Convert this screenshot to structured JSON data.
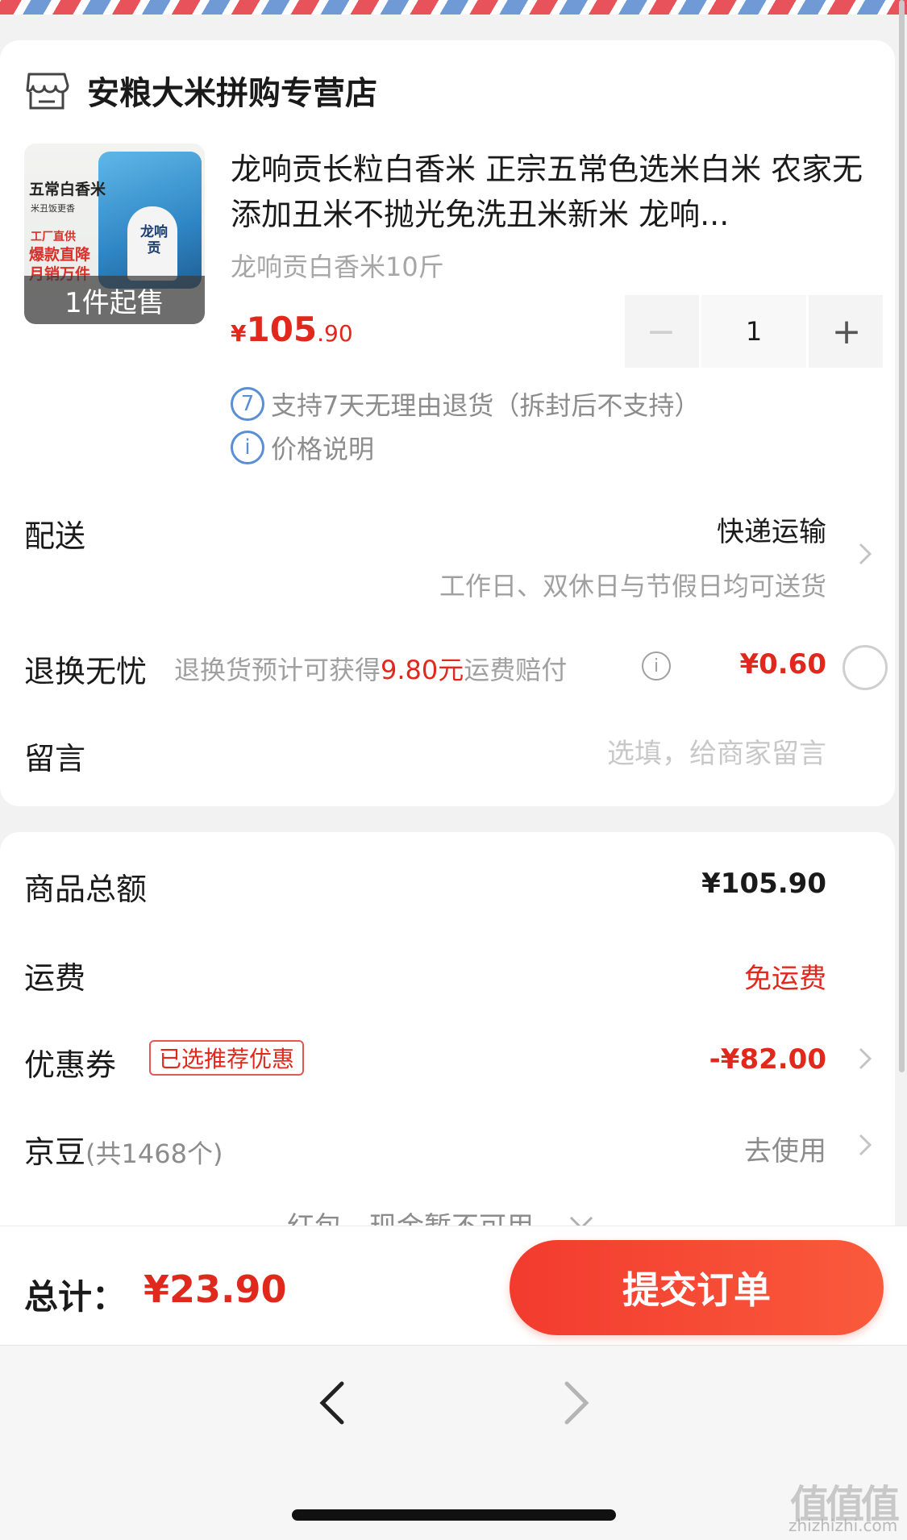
{
  "store": {
    "name": "安粮大米拼购专营店",
    "icon": "store-icon"
  },
  "product": {
    "title": "龙响贡长粒白香米 正宗五常色选米白米 农家无添加丑米不抛光免洗丑米新米 龙响...",
    "spec": "龙响贡白香米10斤",
    "thumbnail": {
      "line1": "五常白香米",
      "line2": "米丑饭更香",
      "line3": "工厂直供",
      "line4a": "爆款直降",
      "line4b": "月销万件",
      "bag_brand": "龙响贡",
      "overlay": "1件起售"
    },
    "price": {
      "currency": "¥",
      "integer": "105",
      "decimal": ".90"
    },
    "quantity": "1",
    "minus_label": "−",
    "plus_label": "+"
  },
  "policies": [
    {
      "icon_text": "7",
      "text": "支持7天无理由退货（拆封后不支持）"
    },
    {
      "icon_text": "i",
      "text": "价格说明"
    }
  ],
  "delivery": {
    "label": "配送",
    "method": "快递运输",
    "note": "工作日、双休日与节假日均可送货"
  },
  "returns": {
    "label": "退换无忧",
    "desc_prefix": "退换货预计可获得",
    "desc_amount": "9.80元",
    "desc_suffix": "运费赔付",
    "info_icon": "i",
    "price": "¥0.60"
  },
  "message": {
    "label": "留言",
    "placeholder": "选填，给商家留言"
  },
  "summary": {
    "goods_total_label": "商品总额",
    "goods_total_value": "¥105.90",
    "shipping_label": "运费",
    "shipping_value": "免运费",
    "coupon_label": "优惠券",
    "coupon_badge": "已选推荐优惠",
    "coupon_value": "-¥82.00",
    "jingdou_label": "京豆",
    "jingdou_count": "(共1468个)",
    "jingdou_action": "去使用",
    "redpack_text": "红包、现金暂不可用"
  },
  "footer": {
    "total_label": "总计：",
    "total_value": "¥23.90",
    "submit_label": "提交订单"
  },
  "watermark": {
    "logo": "值值值",
    "url": "zhizhizhi.com"
  },
  "colors": {
    "accent": "#e0281d",
    "submit": "#f23b2e",
    "info_blue": "#5a8fd6"
  }
}
